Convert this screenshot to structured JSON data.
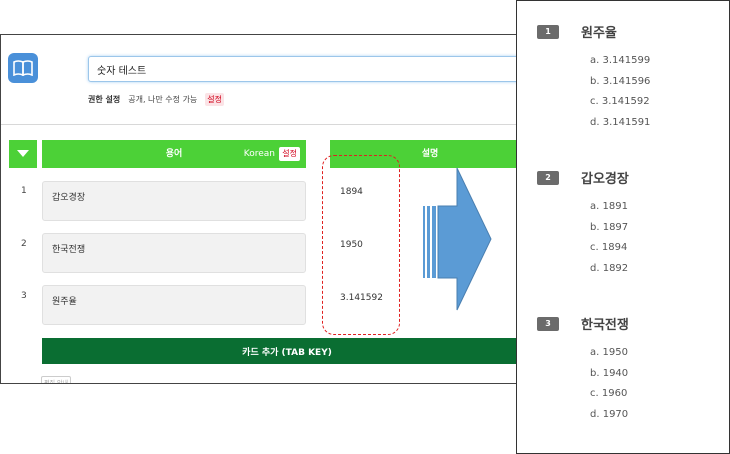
{
  "editor": {
    "title_value": "숫자 테스트",
    "permission": {
      "label": "권한 설정",
      "value": "공개, 나만 수정 가능",
      "set": "설정"
    },
    "header": {
      "term": "용어",
      "language": "Korean",
      "language_set": "설정",
      "description": "설명"
    },
    "rows": [
      {
        "num": "1",
        "term": "갑오경장",
        "desc": "1894"
      },
      {
        "num": "2",
        "term": "한국전쟁",
        "desc": "1950"
      },
      {
        "num": "3",
        "term": "원주율",
        "desc": "3.141592"
      }
    ],
    "add_card": "카드 추가 (TAB KEY)",
    "help": "편집 안내"
  },
  "quiz": {
    "questions": [
      {
        "num": "1",
        "title": "원주율",
        "options": [
          "a. 3.141599",
          "b. 3.141596",
          "c. 3.141592",
          "d. 3.141591"
        ]
      },
      {
        "num": "2",
        "title": "갑오경장",
        "options": [
          "a. 1891",
          "b. 1897",
          "c. 1894",
          "d. 1892"
        ]
      },
      {
        "num": "3",
        "title": "한국전쟁",
        "options": [
          "a. 1950",
          "b. 1940",
          "c. 1960",
          "d. 1970"
        ]
      }
    ]
  },
  "colors": {
    "header_green": "#4cd137",
    "button_dark_green": "#0a6e32",
    "logo_blue": "#4a90d9",
    "arrow_blue": "#5b9bd5",
    "dash_red": "#e02020",
    "badge_gray": "#6b6b6b"
  },
  "icons": {
    "logo": "book-icon",
    "toggle": "triangle-down-icon",
    "arrow": "arrow-right-icon"
  }
}
